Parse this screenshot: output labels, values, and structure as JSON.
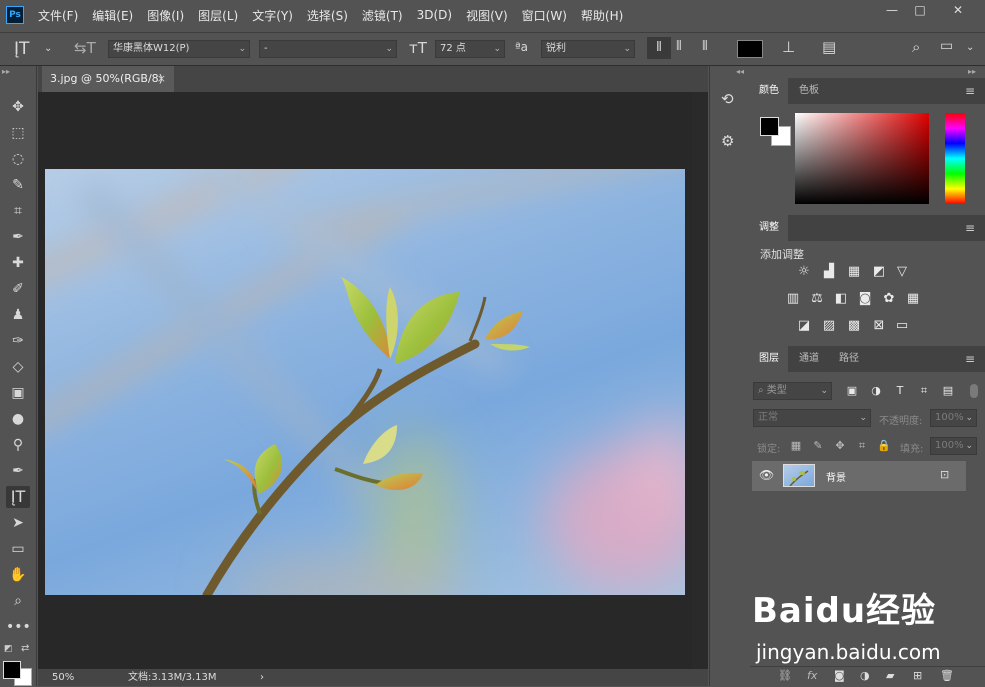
{
  "app": {
    "logo": "Ps"
  },
  "menu": [
    "文件(F)",
    "编辑(E)",
    "图像(I)",
    "图层(L)",
    "文字(Y)",
    "选择(S)",
    "滤镜(T)",
    "3D(D)",
    "视图(V)",
    "窗口(W)",
    "帮助(H)"
  ],
  "window": {
    "minimize": "—",
    "maximize": "□",
    "close": "✕"
  },
  "options": {
    "font_family": "华康黑体W12(P)",
    "font_style": "-",
    "font_size": "72 点",
    "antialias": "锐利",
    "text_color": "#000000"
  },
  "document": {
    "tab_title": "3.jpg @ 50%(RGB/8)",
    "tab_close": "×",
    "zoom": "50%",
    "doc_info": "文档:3.13M/3.13M",
    "status_arrow": "›"
  },
  "panels": {
    "color": {
      "tabs": [
        "颜色",
        "色板"
      ],
      "foreground": "#000000",
      "background": "#ffffff"
    },
    "adjustments": {
      "tab": "调整",
      "title": "添加调整"
    },
    "layers": {
      "tabs": [
        "图层",
        "通道",
        "路径"
      ],
      "filter_placeholder": "类型",
      "blend_mode": "正常",
      "opacity_label": "不透明度:",
      "opacity_value": "100%",
      "lock_label": "锁定:",
      "fill_label": "填充:",
      "fill_value": "100%",
      "layer_name": "背景"
    }
  },
  "watermark": {
    "brand": "Baidu经验",
    "url": "jingyan.baidu.com"
  }
}
